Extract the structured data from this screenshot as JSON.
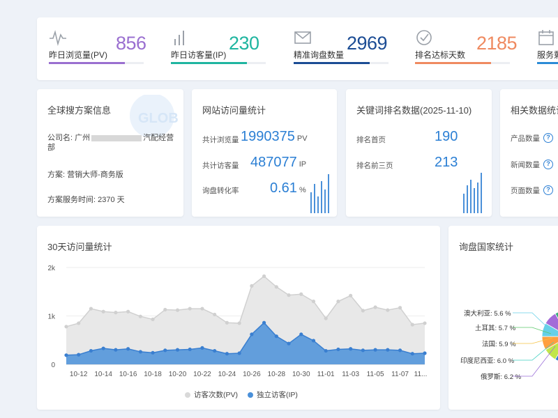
{
  "stats": [
    {
      "label": "昨日浏览量(PV)",
      "value": "856",
      "color": "#9a6fd0",
      "icon": "pulse-icon",
      "fill": 0.8
    },
    {
      "label": "昨日访客量(IP)",
      "value": "230",
      "color": "#1fb5a0",
      "icon": "bar-chart-icon",
      "fill": 0.8
    },
    {
      "label": "精准询盘数量",
      "value": "2969",
      "color": "#1b4c94",
      "icon": "mail-icon",
      "fill": 0.8
    },
    {
      "label": "排名达标天数",
      "value": "2185",
      "color": "#ef8a60",
      "icon": "check-circle-icon",
      "fill": 0.8
    },
    {
      "label": "服务剩",
      "value": "",
      "color": "#2b8bd6",
      "icon": "calendar-icon",
      "fill": 0.8
    }
  ],
  "info": {
    "title": "全球搜方案信息",
    "company_prefix": "公司名: 广州",
    "company_suffix": "汽配经营",
    "company_line2": "部",
    "plan": "方案: 营销大师-商务版",
    "service_time": "方案服务时间: 2370 天"
  },
  "site": {
    "title": "网站访问量统计",
    "pv_label": "共计浏览量",
    "pv_value": "1990375",
    "pv_unit": "PV",
    "ip_label": "共计访客量",
    "ip_value": "487077",
    "ip_unit": "IP",
    "conv_label": "询盘转化率",
    "conv_value": "0.61",
    "conv_unit": "%"
  },
  "keywords": {
    "title": "关键词排名数据(2025-11-10)",
    "first_label": "排名首页",
    "first_value": "190",
    "top3_label": "排名前三页",
    "top3_value": "213"
  },
  "related": {
    "title": "相关数据统计",
    "items": [
      "产品数量",
      "新闻数量",
      "页面数量"
    ]
  },
  "trend": {
    "title": "30天访问量统计",
    "legend_pv": "访客次数(PV)",
    "legend_ip": "独立访客(IP)"
  },
  "country": {
    "title": "询盘国家统计"
  },
  "colors": {
    "accent": "#2b7fd4",
    "pv_area": "#e6e6e6",
    "ip_area": "#4a90d9"
  },
  "chart_data": [
    {
      "type": "area",
      "title": "30天访问量统计",
      "x": [
        "10-11",
        "10-12",
        "10-13",
        "10-14",
        "10-15",
        "10-16",
        "10-17",
        "10-18",
        "10-19",
        "10-20",
        "10-21",
        "10-22",
        "10-23",
        "10-24",
        "10-25",
        "10-26",
        "10-27",
        "10-28",
        "10-29",
        "10-30",
        "10-31",
        "11-01",
        "11-02",
        "11-03",
        "11-04",
        "11-05",
        "11-06",
        "11-07",
        "11-08",
        "11-09"
      ],
      "xtick_labels": [
        "10-12",
        "10-14",
        "10-16",
        "10-18",
        "10-20",
        "10-22",
        "10-24",
        "10-26",
        "10-28",
        "10-30",
        "11-01",
        "11-03",
        "11-05",
        "11-07",
        "11..."
      ],
      "ytick_labels": [
        "0",
        "1k",
        "2k"
      ],
      "ylim": [
        0,
        2000
      ],
      "series": [
        {
          "name": "访客次数(PV)",
          "values": [
            780,
            850,
            1150,
            1090,
            1070,
            1090,
            990,
            930,
            1130,
            1120,
            1150,
            1150,
            1030,
            860,
            850,
            1620,
            1820,
            1600,
            1430,
            1450,
            1300,
            950,
            1300,
            1420,
            1110,
            1180,
            1120,
            1170,
            820,
            850
          ]
        },
        {
          "name": "独立访客(IP)",
          "values": [
            190,
            200,
            280,
            330,
            300,
            320,
            260,
            240,
            290,
            300,
            310,
            340,
            280,
            220,
            230,
            620,
            860,
            580,
            430,
            620,
            490,
            280,
            310,
            320,
            290,
            300,
            300,
            290,
            220,
            230
          ]
        }
      ]
    },
    {
      "type": "pie",
      "title": "询盘国家统计",
      "labels": [
        "澳大利亚",
        "土耳其",
        "法国",
        "印度尼西亚",
        "俄罗斯"
      ],
      "values": [
        5.6,
        5.7,
        5.9,
        6.0,
        6.2
      ],
      "display": [
        "5.6 %",
        "5.7 %",
        "5.9 %",
        "6.0 %",
        "6.2 %"
      ]
    }
  ]
}
